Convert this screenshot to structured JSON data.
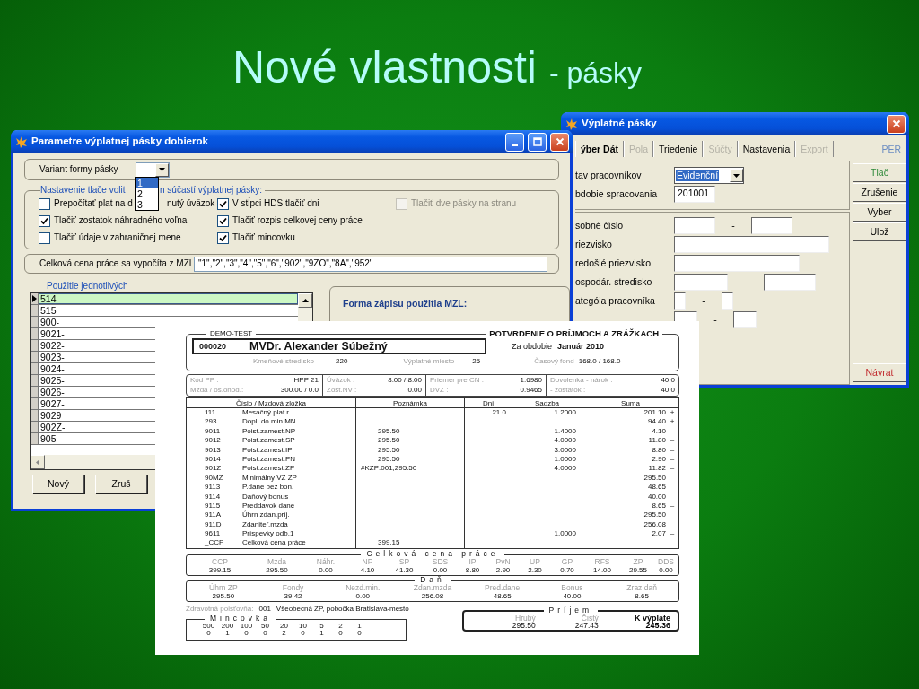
{
  "slide": {
    "title": "Nové vlastnosti",
    "subtitle": "- pásky"
  },
  "right_window": {
    "title": "Výplatné pásky",
    "tabs": [
      {
        "label": "ýber Dát",
        "selected": true,
        "disabled": false
      },
      {
        "label": "Pola",
        "selected": false,
        "disabled": true
      },
      {
        "label": "Triedenie",
        "selected": false,
        "disabled": false
      },
      {
        "label": "Súčty",
        "selected": false,
        "disabled": true
      },
      {
        "label": "Nastavenia",
        "selected": false,
        "disabled": false
      },
      {
        "label": "Export",
        "selected": false,
        "disabled": true
      }
    ],
    "code": "PER",
    "status_fields": [
      {
        "label": "tav pracovníkov",
        "kind": "select",
        "value": "Evidenční"
      },
      {
        "label": "bdobie spracovania",
        "kind": "text",
        "value": "201001"
      }
    ],
    "filters": [
      {
        "label": "sobné číslo",
        "kind": "range",
        "separator": "-"
      },
      {
        "label": "riezvisko",
        "kind": "wide"
      },
      {
        "label": "redošlé priezvisko",
        "kind": "medium"
      },
      {
        "label": "ospodár. stredisko",
        "kind": "range_wide",
        "separator": "-"
      },
      {
        "label": "ategóia pracovníka",
        "kind": "range_small",
        "separator": "-"
      },
      {
        "kind": "range_mid",
        "separator": "-"
      }
    ],
    "buttons": [
      {
        "label": "Tlač",
        "kind": "positive"
      },
      {
        "label": "Zrušenie",
        "kind": "plain"
      },
      {
        "label": "Vyber",
        "kind": "plain"
      },
      {
        "label": "Ulož",
        "kind": "plain"
      },
      {
        "label": "Návrat",
        "kind": "negative"
      }
    ]
  },
  "params_window": {
    "title": "Parametre výplatnej pásky dobierok",
    "variant": {
      "label": "Variant formy pásky",
      "options": [
        {
          "label": "1",
          "selected": true
        },
        {
          "label": "2",
          "selected": false
        },
        {
          "label": "3",
          "selected": false
        }
      ]
    },
    "print_settings": {
      "legend_parts": [
        "Nastavenie tlače volit",
        "n súčastí výplatnej pásky:"
      ],
      "rows": [
        [
          {
            "label_parts": [
              "Prepočítať plat na d",
              "nutý úväzok"
            ],
            "checked": false,
            "disabled": false
          },
          {
            "label": "V stĺpci HDS tlačiť dni",
            "checked": true,
            "disabled": false
          },
          {
            "label": "Tlačiť dve pásky na stranu",
            "checked": false,
            "disabled": true
          }
        ],
        [
          {
            "label": "Tlačiť zostatok náhradného voľna",
            "checked": true,
            "disabled": false
          },
          {
            "label": "Tlačiť rozpis celkovej ceny práce",
            "checked": true,
            "disabled": false
          }
        ],
        [
          {
            "label": "Tlačiť údaje v zahraničnej mene",
            "checked": false,
            "disabled": false
          },
          {
            "label": "Tlačiť mincovku",
            "checked": true,
            "disabled": false
          }
        ]
      ]
    },
    "mzl": {
      "label": "Celková cena práce sa vypočíta z MZL",
      "value": "\"1\",\"2\",\"3\",\"4\",\"5\",\"6\",\"902\",\"9ZO\",\"8A\",\"952\""
    },
    "usage": {
      "legend": "Použitie jednotlivých",
      "rows": [
        {
          "text": "514",
          "selected": true
        },
        {
          "text": "515",
          "selected": false
        },
        {
          "text": "900-",
          "selected": false
        },
        {
          "text": "9021-",
          "selected": false
        },
        {
          "text": "9022-",
          "selected": false
        },
        {
          "text": "9023-",
          "selected": false
        },
        {
          "text": "9024-",
          "selected": false
        },
        {
          "text": "9025-",
          "selected": false
        },
        {
          "text": "9026-",
          "selected": false
        },
        {
          "text": "9027-",
          "selected": false
        },
        {
          "text": "9029",
          "selected": false
        },
        {
          "text": "902Z-",
          "selected": false
        },
        {
          "text": "905-",
          "selected": false
        }
      ],
      "buttons": [
        "Nový",
        "Zruš"
      ],
      "format_title": "Forma zápisu použitia MZL:"
    }
  },
  "payslip": {
    "company": "DEMO-TEST",
    "heading": "POTVRDENIE O PRÍJMOCH A ZRÁŽKACH",
    "employee_id": "000020",
    "employee_name": "MVDr. Alexander Súbežný",
    "period_label": "Za obdobie",
    "period": "Január 2010",
    "info": [
      {
        "label": "Kmeňové stredisko",
        "value": "220"
      },
      {
        "label": "Výplatné miesto",
        "value": "25"
      },
      {
        "label": "Časový fond",
        "value": "168.0 / 168.0"
      }
    ],
    "params": [
      [
        {
          "label": "Kód PP :",
          "value": "HPP 21"
        },
        {
          "label": "Mzda / os.ohod.:",
          "value": "300.00  / 0.0"
        }
      ],
      [
        {
          "label": "Úväzok :",
          "value": "8.00 / 8.00"
        },
        {
          "label": "Zost.NV :",
          "value": "0.00"
        }
      ],
      [
        {
          "label": "Priemer pre CN :",
          "value": "1.6980"
        },
        {
          "label": "DVZ :",
          "value": "0.9465"
        }
      ],
      [
        {
          "label": "Dovolenka - nárok :",
          "value": "40.0"
        },
        {
          "label": "- zostatok :",
          "value": "40.0"
        }
      ]
    ],
    "columns": [
      "Číslo / Mzdová zložka",
      "Poznámka",
      "Dni",
      "Sadzba",
      "Suma"
    ],
    "rows": [
      {
        "code": "111",
        "name": "Mesačný plat r.",
        "days": "21.0",
        "rate": "1.2000",
        "sum": "201.10",
        "sign": "+"
      },
      {
        "code": "293",
        "name": "Dopl. do min.MN",
        "sum": "94.40",
        "sign": "+"
      },
      {
        "code": "9011",
        "name": "Poist.zamest.NP",
        "note": "295.50",
        "rate": "1.4000",
        "sum": "4.10",
        "sign": "–"
      },
      {
        "code": "9012",
        "name": "Poist.zamest.SP",
        "note": "295.50",
        "rate": "4.0000",
        "sum": "11.80",
        "sign": "–"
      },
      {
        "code": "9013",
        "name": "Poist.zamest.IP",
        "note": "295.50",
        "rate": "3.0000",
        "sum": "8.80",
        "sign": "–"
      },
      {
        "code": "9014",
        "name": "Poist.zamest.PN",
        "note": "295.50",
        "rate": "1.0000",
        "sum": "2.90",
        "sign": "–"
      },
      {
        "code": "901Z",
        "name": "Poist.zamest.ZP",
        "note": "#KZP:001;295.50",
        "rate": "4.0000",
        "sum": "11.82",
        "sign": "–"
      },
      {
        "code": "90MZ",
        "name": "Minimálny VZ ZP",
        "sum": "295.50"
      },
      {
        "code": "9113",
        "name": "P.dane bez bon.",
        "sum": "48.65"
      },
      {
        "code": "9114",
        "name": "Daňový bonus",
        "sum": "40.00"
      },
      {
        "code": "9115",
        "name": "Preddavok dane",
        "sum": "8.65",
        "sign": "–"
      },
      {
        "code": "911A",
        "name": "Úhrn zdan.príj.",
        "sum": "295.50"
      },
      {
        "code": "911D",
        "name": "Zdaniteľ.mzda",
        "sum": "256.08"
      },
      {
        "code": "9611",
        "name": "Príspevky odb.1",
        "rate": "1.0000",
        "sum": "2.07",
        "sign": "–"
      },
      {
        "code": "_CCP",
        "name": "Celková cena práce",
        "note": "399.15"
      }
    ],
    "cost_title": "Celková cena práce",
    "cost": [
      {
        "label": "CCP",
        "value": "399.15"
      },
      {
        "label": "Mzda",
        "value": "295.50"
      },
      {
        "label": "Náhr.",
        "value": "0.00"
      },
      {
        "label": "NP",
        "value": "4.10"
      },
      {
        "label": "SP",
        "value": "41.30"
      },
      {
        "label": "SDS",
        "value": "0.00"
      },
      {
        "label": "IP",
        "value": "8.80"
      },
      {
        "label": "PvN",
        "value": "2.90"
      },
      {
        "label": "UP",
        "value": "2.30"
      },
      {
        "label": "GP",
        "value": "0.70"
      },
      {
        "label": "RFS",
        "value": "14.00"
      },
      {
        "label": "ZP",
        "value": "29.55"
      },
      {
        "label": "DDS",
        "value": "0.00"
      }
    ],
    "tax_title": "Daň",
    "tax": [
      {
        "label": "Úhrn ZP",
        "value": "295.50"
      },
      {
        "label": "Fondy",
        "value": "39.42"
      },
      {
        "label": "Nezd.min.",
        "value": "0.00"
      },
      {
        "label": "Zdan.mzda",
        "value": "256.08"
      },
      {
        "label": "Pred.dane",
        "value": "48.65"
      },
      {
        "label": "Bonus",
        "value": "40.00"
      },
      {
        "label": "Zraz.daň",
        "value": "8.65"
      }
    ],
    "insurer_label": "Zdravotná poisťovňa:",
    "insurer_code": "001",
    "insurer_name": "Všeobecná ZP,  pobočka Bratislava-mesto",
    "coins_title": "Mincovka",
    "coins": [
      {
        "denomination": "500",
        "count": "0"
      },
      {
        "denomination": "200",
        "count": "1"
      },
      {
        "denomination": "100",
        "count": "0"
      },
      {
        "denomination": "50",
        "count": "0"
      },
      {
        "denomination": "20",
        "count": "2"
      },
      {
        "denomination": "10",
        "count": "0"
      },
      {
        "denomination": "5",
        "count": "1"
      },
      {
        "denomination": "2",
        "count": "0"
      },
      {
        "denomination": "1",
        "count": "0"
      }
    ],
    "income_title": "Príjem",
    "income": [
      {
        "label": "Hrubý",
        "value": "295.50",
        "kind": "plain"
      },
      {
        "label": "Čistý",
        "value": "247.43",
        "kind": "plain"
      },
      {
        "label": "K výplate",
        "value": "245.36",
        "kind": "total"
      }
    ]
  }
}
